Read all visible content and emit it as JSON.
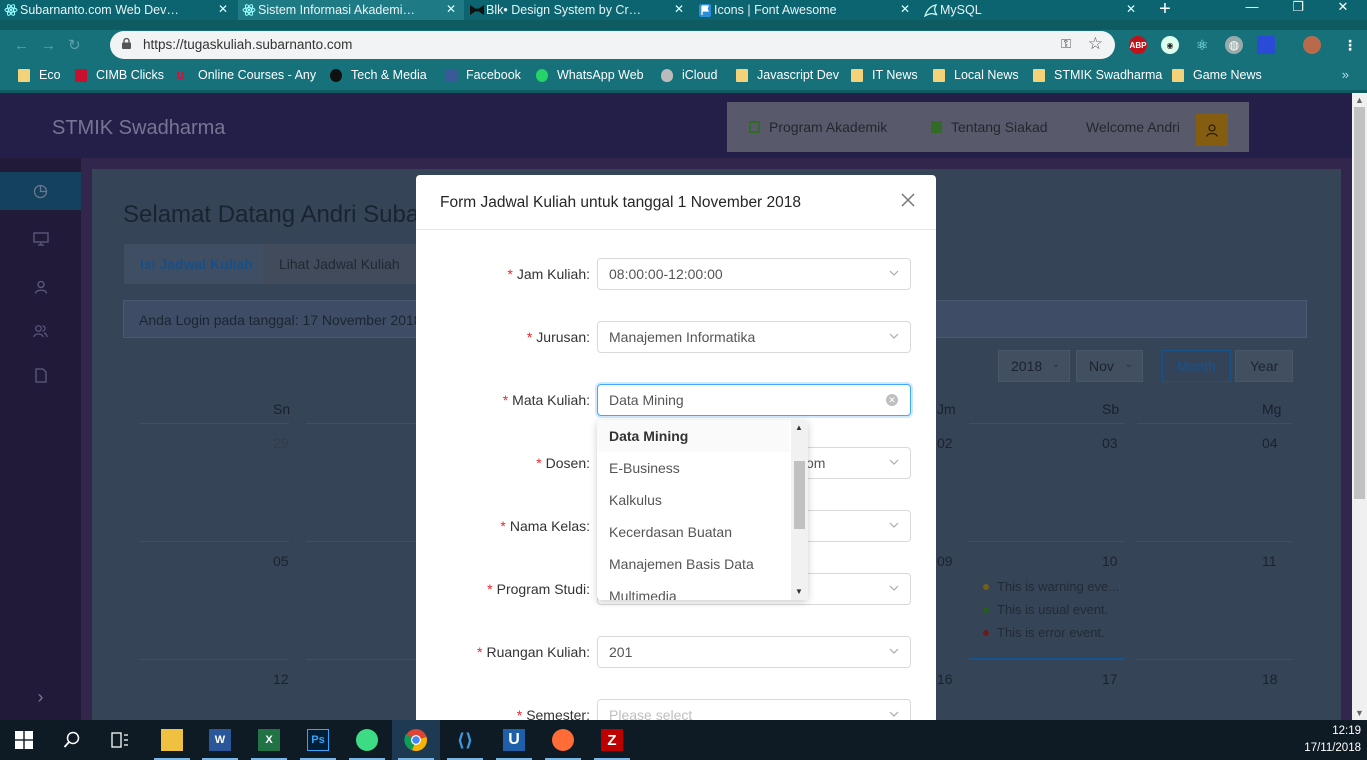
{
  "browser": {
    "tabs": [
      {
        "title": "Subarnanto.com Web Develop",
        "icon": "react-icon"
      },
      {
        "title": "Sistem Informasi Akademik Ka",
        "icon": "react-icon"
      },
      {
        "title": "Blk• Design System by Creative",
        "icon": "bowtie-icon"
      },
      {
        "title": "Icons | Font Awesome",
        "icon": "flag-icon"
      },
      {
        "title": "MySQL",
        "icon": "dolphin-icon"
      }
    ],
    "url": "https://tugaskuliah.subarnanto.com",
    "bookmarks": [
      {
        "label": "Eco"
      },
      {
        "label": "CIMB Clicks"
      },
      {
        "label": "Online Courses - Any"
      },
      {
        "label": "Tech & Media"
      },
      {
        "label": "Facebook"
      },
      {
        "label": "WhatsApp Web"
      },
      {
        "label": "iCloud"
      },
      {
        "label": "Javascript Dev"
      },
      {
        "label": "IT News"
      },
      {
        "label": "Local News"
      },
      {
        "label": "STMIK Swadharma"
      },
      {
        "label": "Game News"
      }
    ],
    "extensions": [
      "ABP"
    ]
  },
  "app": {
    "brand": "STMIK Swadharma",
    "nav": [
      "Program Akademik",
      "Tentang Siakad",
      "Welcome Andri"
    ],
    "welcome": "Selamat Datang Andri Suba",
    "tabs": [
      "Isi Jadwal Kuliah",
      "Lihat Jadwal Kuliah"
    ],
    "login_info": "Anda Login pada tanggal: 17 November 2018",
    "calendar": {
      "year": "2018",
      "month": "Nov",
      "modes": [
        "Month",
        "Year"
      ],
      "weekdays": {
        "sun": "Sn",
        "fri": "Jm",
        "sat": "Sb",
        "mon": "Mg"
      },
      "row1": {
        "sun": "29",
        "fri": "02",
        "sat": "03",
        "mon": "04"
      },
      "row2": {
        "sun": "05",
        "fri": "09",
        "sat": "10",
        "mon": "11"
      },
      "row3": {
        "sun": "12",
        "fri": "16",
        "sat": "17",
        "mon": "18"
      },
      "events": [
        {
          "text": "This is warning eve...",
          "color": "#faad14"
        },
        {
          "text": "This is usual event.",
          "color": "#52c41a"
        },
        {
          "text": "This is error event.",
          "color": "#f5222d"
        }
      ]
    }
  },
  "modal": {
    "title": "Form Jadwal Kuliah untuk tanggal 1 November 2018",
    "fields": [
      {
        "label": "Jam Kuliah",
        "value": "08:00:00-12:00:00"
      },
      {
        "label": "Jurusan",
        "value": "Manajemen Informatika"
      },
      {
        "label": "Mata Kuliah",
        "value": "Data Mining"
      },
      {
        "label": "Dosen",
        "value": "om"
      },
      {
        "label": "Nama Kelas",
        "value": ""
      },
      {
        "label": "Program Studi",
        "value": ""
      },
      {
        "label": "Ruangan Kuliah",
        "value": "201"
      },
      {
        "label": "Semester",
        "placeholder": "Please select"
      }
    ],
    "required_mark": "*",
    "colon": ":",
    "dropdown_options": [
      "Data Mining",
      "E-Business",
      "Kalkulus",
      "Kecerdasan Buatan",
      "Manajemen Basis Data",
      "Multimedia"
    ]
  },
  "taskbar": {
    "time": "12:19",
    "date": "17/11/2018",
    "apps": [
      "windows-start",
      "search",
      "task-view",
      "file-explorer",
      "word",
      "excel",
      "photoshop",
      "android-studio",
      "chrome",
      "vscode",
      "ultraedit",
      "postman",
      "filezilla"
    ]
  }
}
